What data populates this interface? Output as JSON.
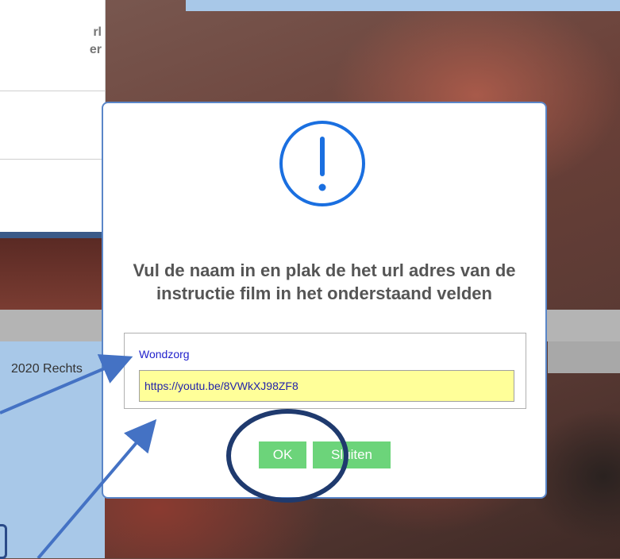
{
  "underlying_page": {
    "snippet_line1": "rl",
    "snippet_line2": "er",
    "footer_text": "2020  Rechts"
  },
  "dialog": {
    "icon": "exclamation-circle-icon",
    "message": "Vul de naam in en plak de het url adres van de instructie film in het onderstaand velden",
    "name_value": "Wondzorg",
    "url_value": "https://youtu.be/8VWkXJ98ZF8",
    "ok_label": "OK",
    "close_label": "Sluiten"
  },
  "colors": {
    "accent_blue": "#1a6fe0",
    "button_green": "#6cd47a",
    "input_yellow": "#ffff99",
    "annotation_blue": "#4472c4",
    "highlight_circle": "#1f3a6e"
  }
}
